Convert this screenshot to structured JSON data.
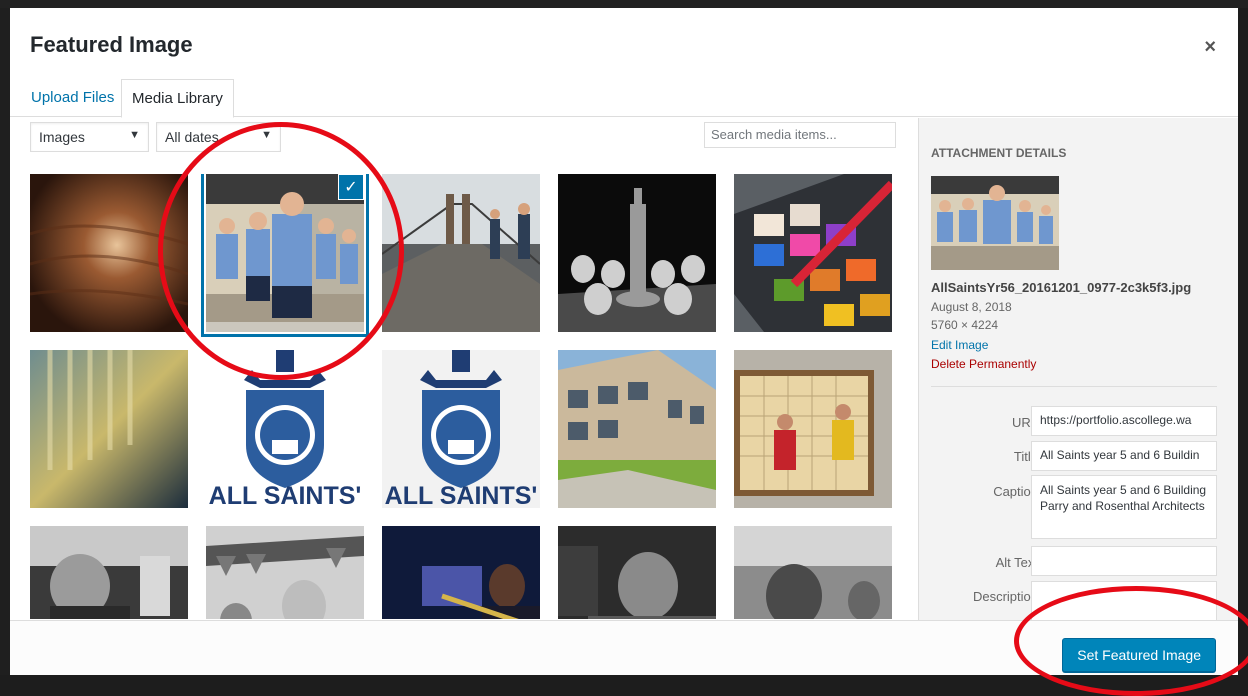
{
  "modal": {
    "title": "Featured Image",
    "close_glyph": "×"
  },
  "tabs": [
    {
      "label": "Upload Files"
    },
    {
      "label": "Media Library"
    }
  ],
  "filters": {
    "type_value": "Images",
    "date_value": "All dates",
    "arrow_glyph": "▼"
  },
  "search": {
    "placeholder": "Search media items..."
  },
  "grid": {
    "check_glyph": "✓",
    "college_text": "ALL SAINTS'",
    "college_text_2": "ALL SAINTS'"
  },
  "details": {
    "heading": "ATTACHMENT DETAILS",
    "filename": "AllSaintsYr56_20161201_0977-2c3k5f3.jpg",
    "date": "August 8, 2018",
    "dimensions": "5760 × 4224",
    "edit_label": "Edit Image",
    "delete_label": "Delete Permanently",
    "fields": {
      "url_label": "URL",
      "url_value": "https://portfolio.ascollege.wa",
      "title_label": "Title",
      "title_value": "All Saints year 5 and 6 Buildin",
      "caption_label": "Caption",
      "caption_value": "All Saints year 5 and 6 Building Parry and Rosenthal Architects",
      "alt_label": "Alt Text",
      "alt_value": "",
      "desc_label": "Description",
      "desc_value": ""
    }
  },
  "footer": {
    "button_label": "Set Featured Image"
  },
  "colors": {
    "accent": "#0073aa",
    "button": "#0085ba",
    "danger": "#a00000",
    "annotation": "#e60b17"
  }
}
